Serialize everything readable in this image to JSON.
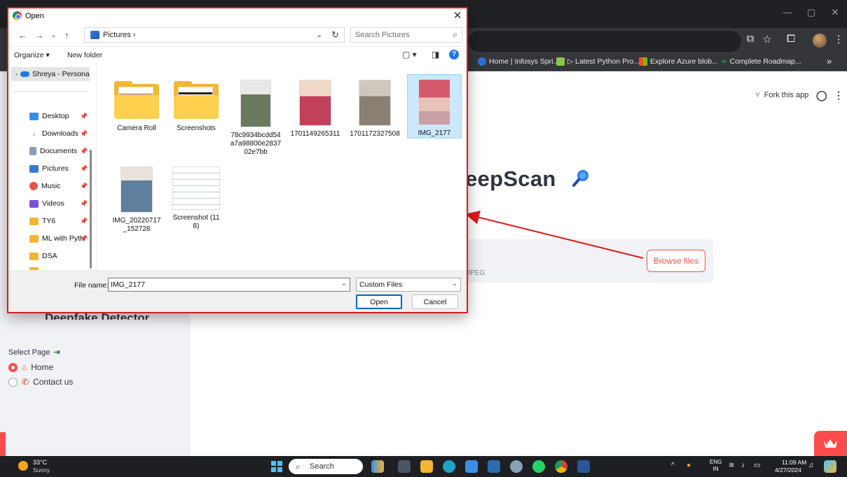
{
  "colors": {
    "accent": "#ff4b4b",
    "dialog_border": "#d21f1f",
    "selection": "#cce8ff"
  },
  "chrome": {
    "bookmarks": [
      {
        "label": "Home | Infosys Spri...",
        "color": "#2f6fd6"
      },
      {
        "label": "▷ Latest Python Pro...",
        "color": "#8bc34a"
      },
      {
        "label": "Explore Azure blob...",
        "color": "#f25022"
      },
      {
        "label": "Complete Roadmap...",
        "color": "#22c55e"
      }
    ],
    "more": "»"
  },
  "page": {
    "fork_label": "Fork this app",
    "title": "eepScan",
    "uploader_limits": "JPEG",
    "browse_label": "Browse files",
    "sidebar_heading": "Deepfake Detector",
    "select_page_label": "Select Page",
    "radio_options": [
      {
        "label": "Home",
        "selected": true,
        "icon": "house-icon"
      },
      {
        "label": "Contact us",
        "selected": false,
        "icon": "phone-icon"
      }
    ]
  },
  "dialog": {
    "title": "Open",
    "address_path": "Pictures  ›",
    "search_placeholder": "Search Pictures",
    "organize_label": "Organize ▾",
    "new_folder_label": "New folder",
    "nav_items": [
      {
        "label": "Shreya - Persona",
        "icon": "onedrive-icon"
      },
      {
        "label": "Desktop",
        "icon": "desktop-icon",
        "color": "#3a8ee6"
      },
      {
        "label": "Downloads",
        "icon": "download-icon",
        "color": "#2b7cd3"
      },
      {
        "label": "Documents",
        "icon": "document-icon",
        "color": "#8aa0b8"
      },
      {
        "label": "Pictures",
        "icon": "pictures-icon",
        "color": "#3a78d4"
      },
      {
        "label": "Music",
        "icon": "music-icon",
        "color": "#e2574c"
      },
      {
        "label": "Videos",
        "icon": "videos-icon",
        "color": "#7b4fd6"
      },
      {
        "label": "TY6",
        "icon": "folder-icon",
        "color": "#f2b632"
      },
      {
        "label": "ML with Pyth",
        "icon": "folder-icon",
        "color": "#f2b632"
      },
      {
        "label": "DSA",
        "icon": "folder-icon",
        "color": "#f2b632"
      }
    ],
    "files": [
      {
        "name": "Camera Roll",
        "kind": "folder"
      },
      {
        "name": "Screenshots",
        "kind": "folder"
      },
      {
        "name": "78c9934bcdd54a7a98800e283702e7bb",
        "kind": "photo",
        "color": "#6b7a5e"
      },
      {
        "name": "1701149265311",
        "kind": "photo",
        "color": "#c2415a"
      },
      {
        "name": "1701172327508",
        "kind": "photo",
        "color": "#8a8073"
      },
      {
        "name": "IMG_2177",
        "kind": "photo",
        "color": "#d65a6e",
        "selected": true
      },
      {
        "name": "IMG_20220717_152728",
        "kind": "photo",
        "color": "#5f7f9e"
      },
      {
        "name": "Screenshot (118)",
        "kind": "doc"
      }
    ],
    "file_name_label": "File name:",
    "file_name_value": "IMG_2177",
    "filter_label": "Custom Files",
    "open_label": "Open",
    "cancel_label": "Cancel"
  },
  "taskbar": {
    "temp": "33°C",
    "weather": "Sunny",
    "search_label": "Search",
    "lang_line1": "ENG",
    "lang_line2": "IN",
    "time": "11:09 AM",
    "date": "4/27/2024"
  }
}
